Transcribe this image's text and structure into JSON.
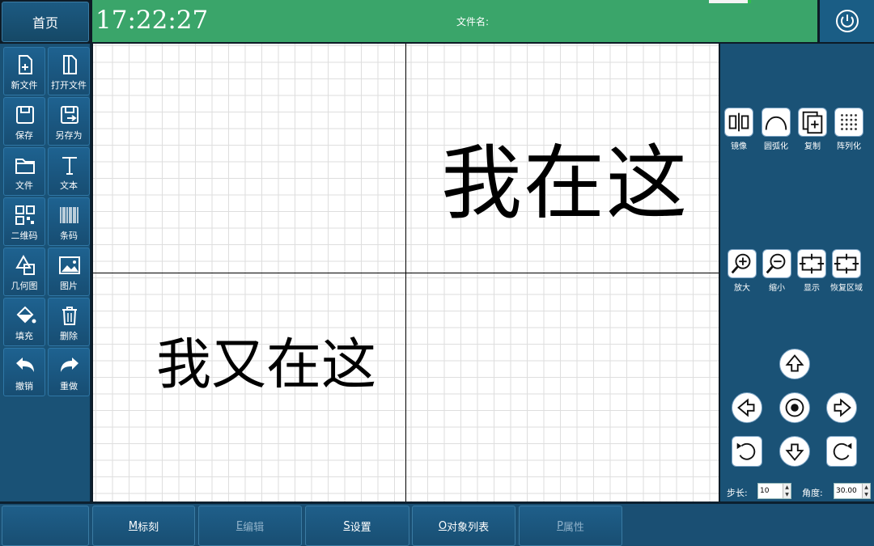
{
  "header": {
    "home_label": "首页",
    "clock": "17:22:27",
    "file_name_label": "文件名:"
  },
  "icons": {
    "power": "power-icon"
  },
  "left_tools": [
    {
      "label": "新文件",
      "icon": "new-file-icon"
    },
    {
      "label": "打开文件",
      "icon": "open-file-icon"
    },
    {
      "label": "保存",
      "icon": "save-icon"
    },
    {
      "label": "另存为",
      "icon": "save-as-icon"
    },
    {
      "label": "文件",
      "icon": "folder-icon"
    },
    {
      "label": "文本",
      "icon": "text-icon"
    },
    {
      "label": "二维码",
      "icon": "qrcode-icon"
    },
    {
      "label": "条码",
      "icon": "barcode-icon"
    },
    {
      "label": "几何图",
      "icon": "geometry-icon"
    },
    {
      "label": "图片",
      "icon": "image-icon"
    },
    {
      "label": "填充",
      "icon": "fill-icon"
    },
    {
      "label": "删除",
      "icon": "trash-icon"
    },
    {
      "label": "撤销",
      "icon": "undo-icon"
    },
    {
      "label": "重做",
      "icon": "redo-icon"
    }
  ],
  "canvas": {
    "text_1": "我在这",
    "text_2": "我又在这"
  },
  "right_tools": {
    "row1": [
      "镜像",
      "圆弧化",
      "复制",
      "阵列化"
    ],
    "row2": [
      "放大",
      "缩小",
      "显示",
      "恢复区域"
    ]
  },
  "move": {
    "step_label": "步长:",
    "step_value": "10",
    "angle_label": "角度:",
    "angle_value": "30.00"
  },
  "tabs": [
    {
      "key": "M",
      "label": "标刻"
    },
    {
      "key": "E",
      "label": "编辑"
    },
    {
      "key": "S",
      "label": "设置"
    },
    {
      "key": "O",
      "label": "对象列表"
    },
    {
      "key": "P",
      "label": "属性"
    }
  ]
}
